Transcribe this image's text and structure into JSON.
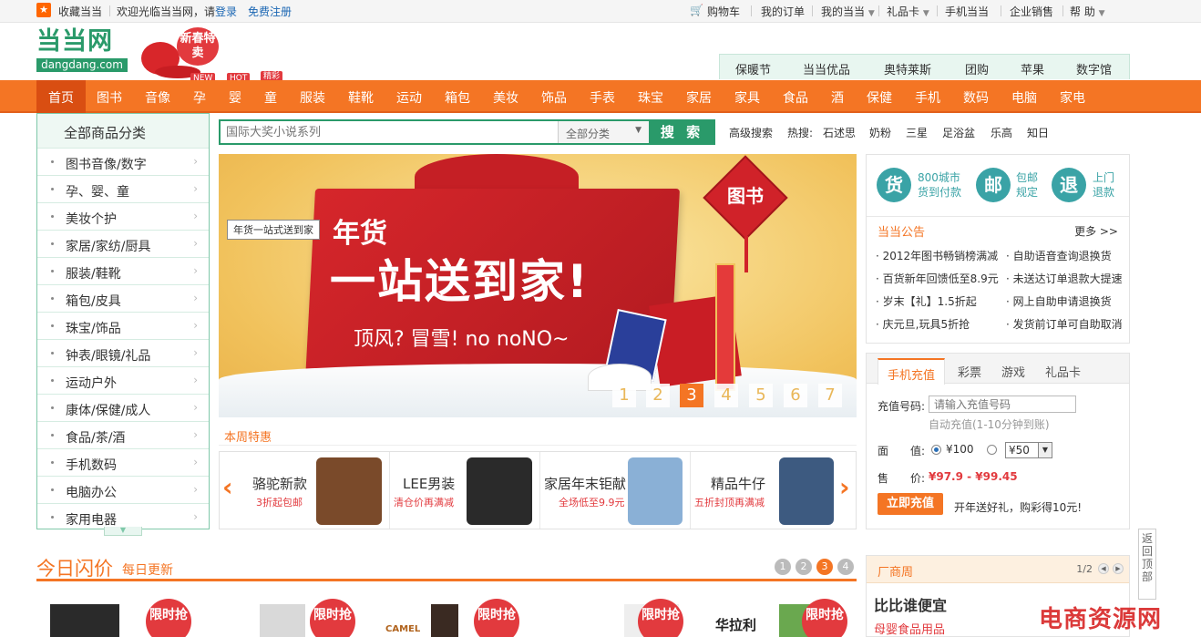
{
  "topbar": {
    "favorite": "收藏当当",
    "welcome": "欢迎光临当当网，请",
    "login": "登录",
    "register": "免费注册",
    "cart": "购物车",
    "orders": "我的订单",
    "my_dangdang": "我的当当",
    "gift_card": "礼品卡",
    "mobile": "手机当当",
    "enterprise": "企业销售",
    "help": "帮 助"
  },
  "logo": {
    "cn": "当当网",
    "en": "dangdang.com"
  },
  "festive": {
    "text": "新春特卖"
  },
  "sub_nav": [
    "保暖节",
    "当当优品",
    "奥特莱斯",
    "团购",
    "苹果",
    "数字馆"
  ],
  "main_nav": [
    "首页",
    "图书",
    "音像",
    "孕",
    "婴",
    "童",
    "服装",
    "鞋靴",
    "运动",
    "箱包",
    "美妆",
    "饰品",
    "手表",
    "珠宝",
    "家居",
    "家具",
    "食品",
    "酒",
    "保健",
    "手机",
    "数码",
    "电脑",
    "家电"
  ],
  "nav_tags": {
    "new": "NEW",
    "hot": "HOT",
    "jing": "精彩"
  },
  "category": {
    "title": "全部商品分类",
    "items": [
      "图书音像/数字",
      "孕、婴、童",
      "美妆个护",
      "家居/家纺/厨具",
      "服装/鞋靴",
      "箱包/皮具",
      "珠宝/饰品",
      "钟表/眼镜/礼品",
      "运动户外",
      "康体/保健/成人",
      "食品/茶/酒",
      "手机数码",
      "电脑办公",
      "家用电器"
    ]
  },
  "search": {
    "placeholder": "国际大奖小说系列",
    "category": "全部分类",
    "button": "搜 索",
    "advanced": "高级搜索",
    "hot_label": "热搜:",
    "hot_words": [
      "石述思",
      "奶粉",
      "三星",
      "足浴盆",
      "乐高",
      "知日"
    ]
  },
  "banner": {
    "tag": "年货一站式送到家",
    "line1": "年货",
    "line2": "一站送到家!",
    "line3": "顶风? 冒雪! no noNO~",
    "badge": "图书",
    "pages": [
      "1",
      "2",
      "3",
      "4",
      "5",
      "6",
      "7"
    ],
    "active_page": 3
  },
  "weekly": {
    "title": "本周特惠",
    "items": [
      {
        "name": "骆驼新款",
        "sub": "3折起包邮",
        "color": "#7a4a2a"
      },
      {
        "name": "LEE男装",
        "sub": "清仓价再满减",
        "color": "#2a2a2a"
      },
      {
        "name": "家居年末钜献",
        "sub": "全场低至9.9元",
        "color": "#8ab0d6"
      },
      {
        "name": "精品牛仔",
        "sub": "五折封顶再满减",
        "color": "#3d5a80"
      }
    ]
  },
  "service": {
    "items": [
      {
        "icon": "货",
        "text1": "800城市",
        "text2": "货到付款"
      },
      {
        "icon": "邮",
        "text1": "包邮",
        "text2": "规定"
      },
      {
        "icon": "退",
        "text1": "上门",
        "text2": "退款"
      }
    ],
    "announce": "当当公告",
    "more": "更多 >>",
    "news_left": [
      "2012年图书畅销榜满减",
      "百货新年回馈低至8.9元",
      "岁末【礼】1.5折起",
      "庆元旦,玩具5折抢"
    ],
    "news_right": [
      "自助语音查询退换货",
      "未送达订单退款大提速",
      "网上自助申请退换货",
      "发货前订单可自助取消"
    ]
  },
  "recharge": {
    "tabs": [
      "手机充值",
      "彩票",
      "游戏",
      "礼品卡"
    ],
    "phone_label": "充值号码:",
    "phone_placeholder": "请输入充值号码",
    "hint": "自动充值(1-10分钟到账)",
    "value_label": "面　　值:",
    "opt1": "¥100",
    "opt2": "¥50",
    "price_label": "售　　价:",
    "price": "¥97.9 - ¥99.45",
    "button": "立即充值",
    "promo": "开年送好礼，购彩得10元!"
  },
  "flash": {
    "title": "今日闪价",
    "subtitle": "每日更新",
    "pages": [
      "1",
      "2",
      "3",
      "4"
    ],
    "active_page": 3,
    "tag": "限时抢",
    "brand_camel": "CAMEL",
    "brand_hualali": "华拉利"
  },
  "factory": {
    "title": "厂商周",
    "page": "1/2",
    "headline": "比比谁便宜",
    "sub": "母婴食品用品"
  },
  "watermark": "电商资源网",
  "back_top": "返回顶部",
  "colors": {
    "orange": "#f47524",
    "green": "#2a9a6a",
    "red": "#e23a3e",
    "teal": "#3aa3a6"
  }
}
